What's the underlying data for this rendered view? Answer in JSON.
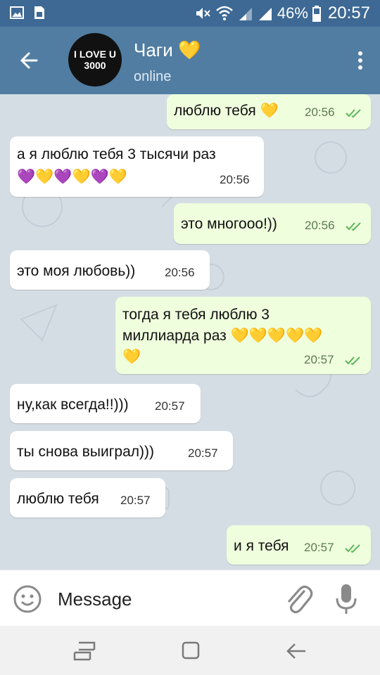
{
  "status_bar": {
    "battery": "46%",
    "time": "20:57"
  },
  "header": {
    "avatar_lines": [
      "I LOVE U",
      "3000"
    ],
    "title": "Чаги 💛",
    "status": "online"
  },
  "messages": [
    {
      "dir": "out",
      "text": "люблю тебя 💛",
      "time": "20:56",
      "read": true
    },
    {
      "dir": "in",
      "text": [
        "а я люблю тебя 3 тысячи раз",
        "💜💛💜💛💜💛"
      ],
      "time": "20:56"
    },
    {
      "dir": "out",
      "text": "это многооо!))",
      "time": "20:56",
      "read": true
    },
    {
      "dir": "in",
      "text": "это моя любовь))",
      "time": "20:56"
    },
    {
      "dir": "out",
      "text": [
        "тогда я тебя люблю 3",
        "миллиарда раз 💛💛💛💛💛",
        "💛"
      ],
      "time": "20:57",
      "read": true
    },
    {
      "dir": "in",
      "text": "ну,как всегда!!)))",
      "time": "20:57"
    },
    {
      "dir": "in",
      "text": "ты снова выиграл)))",
      "time": "20:57"
    },
    {
      "dir": "in",
      "text": "люблю тебя",
      "time": "20:57"
    },
    {
      "dir": "out",
      "text": "и я тебя",
      "time": "20:57",
      "read": true
    }
  ],
  "input": {
    "placeholder": "Message"
  },
  "colors": {
    "header": "#517da2",
    "status_bar": "#3d6994",
    "outgoing_bubble": "#effedd",
    "incoming_bubble": "#ffffff",
    "check": "#5cb55b"
  },
  "icons": [
    "image-icon",
    "sim-icon",
    "mute-icon",
    "wifi-icon",
    "signal-icon",
    "battery-icon",
    "back-arrow-icon",
    "menu-dots-icon",
    "emoji-icon",
    "paperclip-icon",
    "microphone-icon",
    "recent-apps-icon",
    "home-icon",
    "nav-back-icon"
  ]
}
